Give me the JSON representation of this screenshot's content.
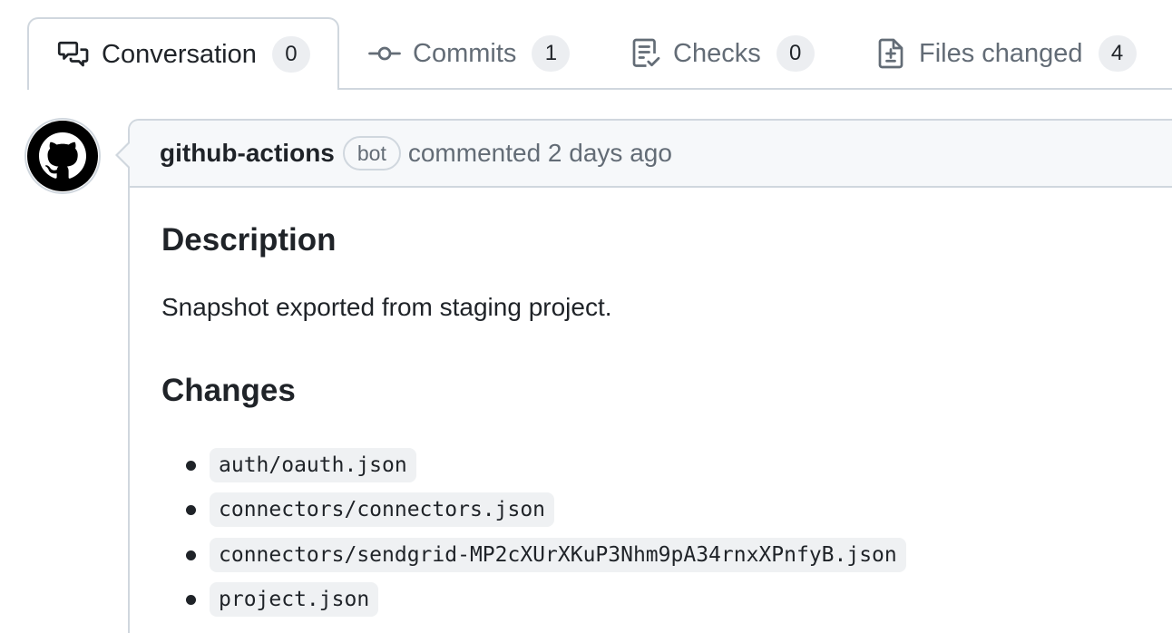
{
  "tabs": [
    {
      "label": "Conversation",
      "count": "0",
      "icon": "comment-discussion-icon"
    },
    {
      "label": "Commits",
      "count": "1",
      "icon": "git-commit-icon"
    },
    {
      "label": "Checks",
      "count": "0",
      "icon": "checklist-icon"
    },
    {
      "label": "Files changed",
      "count": "4",
      "icon": "file-diff-icon"
    }
  ],
  "comment": {
    "author": "github-actions",
    "badge": "bot",
    "action": "commented 2 days ago",
    "description_heading": "Description",
    "description_text": "Snapshot exported from staging project.",
    "changes_heading": "Changes",
    "files": [
      "auth/oauth.json",
      "connectors/connectors.json",
      "connectors/sendgrid-MP2cXUrXKuP3Nhm9pA34rnxXPnfyB.json",
      "project.json"
    ]
  },
  "colors": {
    "text": "#1f2328",
    "muted": "#636c76",
    "border": "#d0d7de",
    "header_bg": "#f6f8fa",
    "counter_bg": "#eceef1",
    "code_bg": "#eff1f3"
  }
}
